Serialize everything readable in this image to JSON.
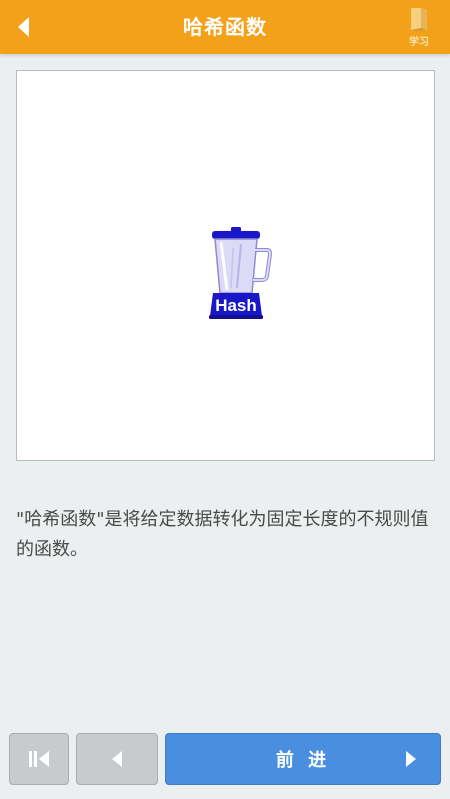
{
  "header": {
    "title": "哈希函数",
    "back_icon": "chevron-left-icon",
    "study_label": "学习",
    "study_icon": "book-icon",
    "background_color": "#f2a118"
  },
  "illustration": {
    "icon": "blender-icon",
    "label": "Hash",
    "accent_color": "#1a17c8"
  },
  "description": "\"哈希函数\"是将给定数据转化为固定长度的不规则值的函数。",
  "bottom_nav": {
    "first_icon": "skip-to-start-icon",
    "prev_icon": "chevron-left-icon",
    "next_label": "前 进",
    "next_icon": "chevron-right-icon",
    "next_color": "#4a8ee0"
  }
}
